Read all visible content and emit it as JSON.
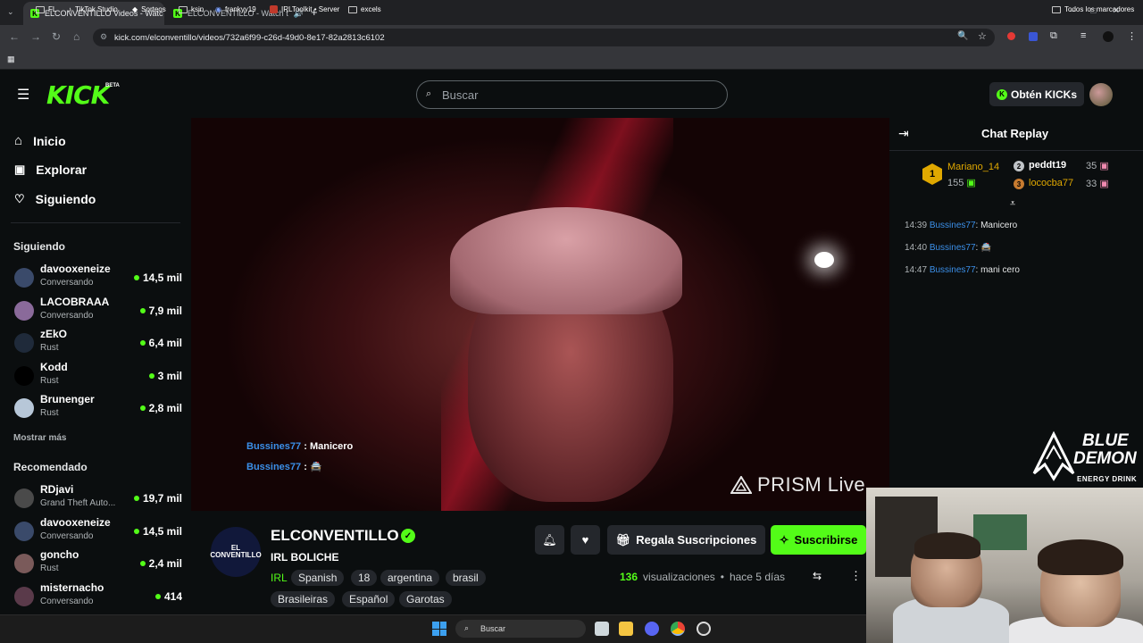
{
  "browser": {
    "tabs": [
      {
        "label": "ELCONVENTILLO Videos - Watc",
        "active": true
      },
      {
        "label": "ELCONVENTILLO - Watch t",
        "active": false
      }
    ],
    "new_tab": "+",
    "url": "kick.com/elconventillo/videos/732a6f99-c26d-49d0-8e17-82a2813c6102",
    "bookmarks": [
      "FL",
      "TikTok Studio",
      "Sorteos",
      "ksin",
      "frankyy19",
      "IRLToolkit • Server",
      "excels"
    ],
    "all_bookmarks": "Todos los marcadores"
  },
  "header": {
    "logo": "KICK",
    "beta": "BETA",
    "search_placeholder": "Buscar",
    "kicks_button": "Obtén KICKs"
  },
  "sidebar": {
    "nav": [
      {
        "label": "Inicio",
        "icon": "home-icon"
      },
      {
        "label": "Explorar",
        "icon": "compass-icon"
      },
      {
        "label": "Siguiendo",
        "icon": "heart-icon"
      }
    ],
    "following_title": "Siguiendo",
    "following": [
      {
        "name": "davooxeneize",
        "sub": "Conversando",
        "viewers": "14,5 mil",
        "color": "#3a4a6a"
      },
      {
        "name": "LACOBRAAA",
        "sub": "Conversando",
        "viewers": "7,9 mil",
        "color": "#8a6a9a"
      },
      {
        "name": "zEkO",
        "sub": "Rust",
        "viewers": "6,4 mil",
        "color": "#1f2a3a"
      },
      {
        "name": "Kodd",
        "sub": "Rust",
        "viewers": "3 mil",
        "color": "#000000"
      },
      {
        "name": "Brunenger",
        "sub": "Rust",
        "viewers": "2,8 mil",
        "color": "#b7c7d8"
      }
    ],
    "show_more": "Mostrar más",
    "recommended_title": "Recomendado",
    "recommended": [
      {
        "name": "RDjavi",
        "sub": "Grand Theft Auto...",
        "viewers": "19,7 mil",
        "color": "#4a4a4a"
      },
      {
        "name": "davooxeneize",
        "sub": "Conversando",
        "viewers": "14,5 mil",
        "color": "#3a4a6a"
      },
      {
        "name": "goncho",
        "sub": "Rust",
        "viewers": "2,4 mil",
        "color": "#7a5a5a"
      },
      {
        "name": "misternacho",
        "sub": "Conversando",
        "viewers": "414",
        "color": "#5a3a4a"
      }
    ]
  },
  "video": {
    "chat_overlay": [
      {
        "user": "Bussines77",
        "msg": "Manicero"
      },
      {
        "user": "Bussines77",
        "msg": "🚔"
      }
    ],
    "watermark": "PRISM Live"
  },
  "channel": {
    "logo_text": "EL CONVENTILLO",
    "name": "ELCONVENTILLO",
    "title": "IRL BOLICHE",
    "category": "IRL",
    "tags": [
      "Spanish",
      "18",
      "argentina",
      "brasil",
      "Brasileiras",
      "Español",
      "Garotas"
    ],
    "gift_button": "Regala Suscripciones",
    "subscribe_button": "Suscribirse",
    "views_count": "136",
    "views_label": "visualizaciones",
    "separator": "•",
    "date": "hace 5 días"
  },
  "chat": {
    "title": "Chat Replay",
    "top_gifters": [
      {
        "rank": "1",
        "name": "Mariano_14",
        "count": "155"
      },
      {
        "rank": "2",
        "name": "peddt19",
        "count": "35"
      },
      {
        "rank": "3",
        "name": "lococba77",
        "count": "33"
      }
    ],
    "messages": [
      {
        "time": "14:39",
        "user": "Bussines77",
        "msg": "Manicero"
      },
      {
        "time": "14:40",
        "user": "Bussines77",
        "msg": "🚔"
      },
      {
        "time": "14:47",
        "user": "Bussines77",
        "msg": "mani cero"
      }
    ]
  },
  "overlay": {
    "brand_line1": "BLUE",
    "brand_line2": "DEMON",
    "brand_line3": "ENERGY DRINK"
  },
  "taskbar": {
    "search_placeholder": "Buscar"
  }
}
